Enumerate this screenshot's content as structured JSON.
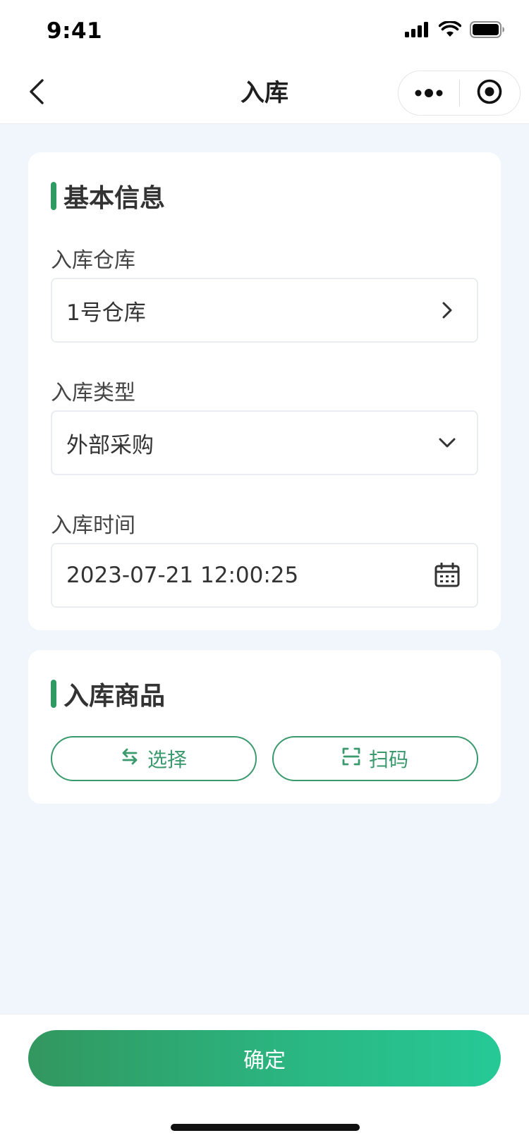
{
  "status_bar": {
    "time": "9:41"
  },
  "nav": {
    "title": "入库",
    "icons": {
      "back": "chevron-left-icon",
      "more": "more-dots-icon",
      "close": "target-icon"
    }
  },
  "basic_info": {
    "title": "基本信息",
    "fields": [
      {
        "label": "入库仓库",
        "value": "1号仓库",
        "icon": "chevron-right-icon"
      },
      {
        "label": "入库类型",
        "value": "外部采购",
        "icon": "chevron-down-icon"
      },
      {
        "label": "入库时间",
        "value": "2023-07-21 12:00:25",
        "icon": "calendar-icon"
      }
    ]
  },
  "goods": {
    "title": "入库商品",
    "select_label": "选择",
    "scan_label": "扫码",
    "icons": {
      "select": "swap-icon",
      "scan": "scan-icon"
    }
  },
  "footer": {
    "confirm_label": "确定"
  },
  "colors": {
    "accent": "#3a9a6d",
    "section_bar": "#2f9b63",
    "gradient_start": "#32975f",
    "gradient_end": "#26c996",
    "page_bg": "#f1f6fd"
  }
}
